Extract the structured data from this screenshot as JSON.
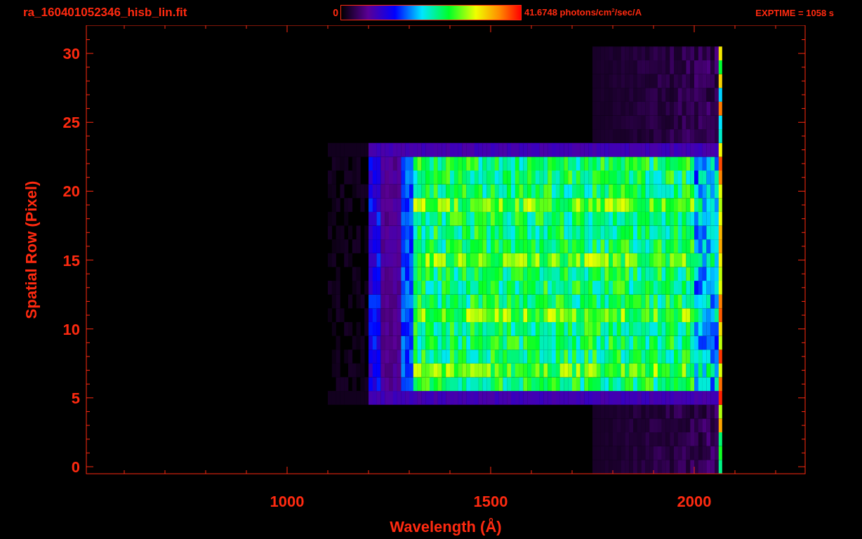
{
  "header": {
    "title": "ra_160401052346_hisb_lin.fit",
    "colorbar": {
      "min_label": "0",
      "max_label": "41.6748 photons/cm$^{2}$/sec/A"
    },
    "exposure": "EXPTIME = 1058 s"
  },
  "plot": {
    "xlabel": "Wavelength (Å)",
    "ylabel": "Spatial Row (Pixel)",
    "xtick_labels": [
      "1000",
      "1500",
      "2000"
    ],
    "ytick_labels": [
      "30",
      "25",
      "20",
      "15",
      "10",
      "5",
      "0"
    ]
  }
}
